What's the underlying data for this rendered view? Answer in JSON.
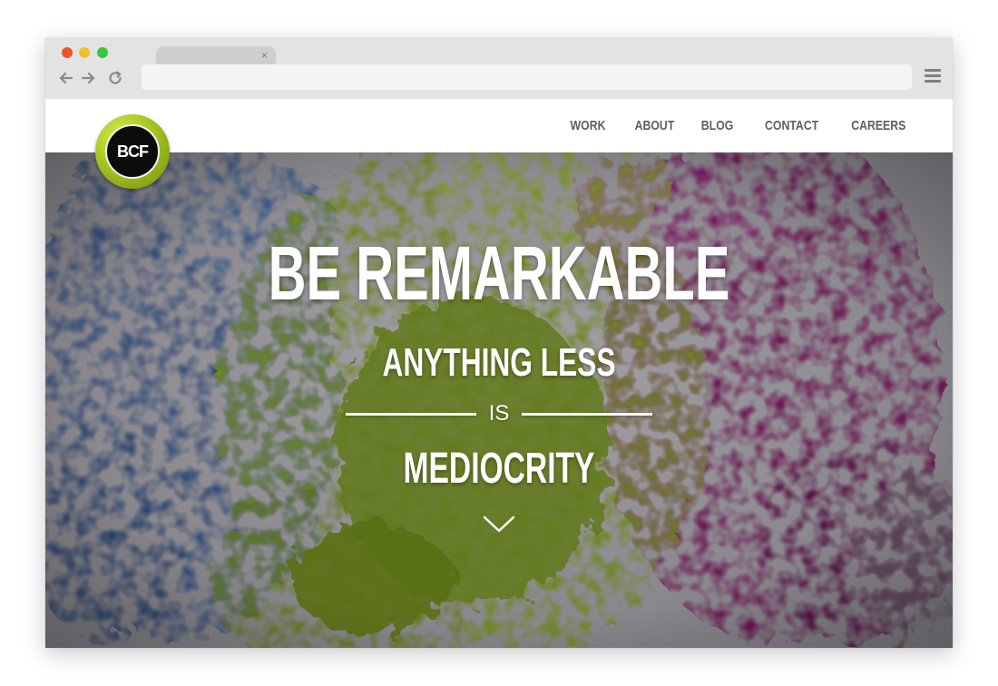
{
  "browser": {
    "traffic_lights": {
      "close_color": "#f0542a",
      "minimize_color": "#f5be2a",
      "maximize_color": "#3cc63a"
    },
    "tab": {
      "title": "",
      "close_glyph": "×"
    },
    "nav_icons": [
      "back-arrow-icon",
      "forward-arrow-icon",
      "reload-icon"
    ],
    "address_bar": {
      "value": "",
      "placeholder": ""
    },
    "menu_icon": "hamburger-menu-icon"
  },
  "site": {
    "logo": {
      "text": "BCF",
      "ring_color": "#a4c520"
    },
    "nav": [
      {
        "label": "WORK"
      },
      {
        "label": "ABOUT"
      },
      {
        "label": "BLOG"
      },
      {
        "label": "CONTACT"
      },
      {
        "label": "CAREERS"
      }
    ]
  },
  "hero": {
    "headline": "BE REMARKABLE",
    "line2": "ANYTHING LESS",
    "divider_word": "IS",
    "line3": "MEDIOCRITY",
    "scroll_icon": "chevron-down-icon",
    "colors": {
      "background": "#a9a7ad",
      "splash_blue": "#3c5a8a",
      "splash_green": "#7d9a25",
      "splash_magenta": "#7a1a5e"
    }
  }
}
